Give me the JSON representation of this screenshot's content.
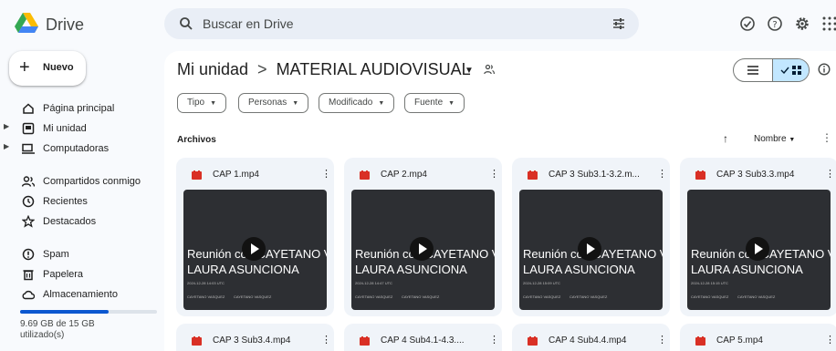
{
  "app": {
    "name": "Drive"
  },
  "search": {
    "placeholder": "Buscar en Drive"
  },
  "sidebar": {
    "new_label": "Nuevo",
    "items": [
      {
        "label": "Página principal",
        "icon": "home-icon"
      },
      {
        "label": "Mi unidad",
        "icon": "my-drive-icon"
      },
      {
        "label": "Computadoras",
        "icon": "computers-icon"
      },
      {
        "label": "Compartidos conmigo",
        "icon": "shared-icon"
      },
      {
        "label": "Recientes",
        "icon": "recent-icon"
      },
      {
        "label": "Destacados",
        "icon": "star-icon"
      },
      {
        "label": "Spam",
        "icon": "spam-icon"
      },
      {
        "label": "Papelera",
        "icon": "trash-icon"
      },
      {
        "label": "Almacenamiento",
        "icon": "cloud-icon"
      }
    ],
    "storage_text": "9.69 GB de 15 GB utilizado(s)",
    "storage_fraction": 0.646
  },
  "breadcrumb": {
    "root": "Mi unidad",
    "separator": ">",
    "current": "MATERIAL AUDIOVISUAL"
  },
  "filters": {
    "tipo": "Tipo",
    "personas": "Personas",
    "modificado": "Modificado",
    "fuente": "Fuente"
  },
  "section": {
    "title": "Archivos"
  },
  "sort": {
    "label": "Nombre"
  },
  "files": [
    {
      "name": "CAP 1.mp4",
      "title1": "Reunión con CAYETANO VA",
      "title2": "LAURA ASUNCIONA",
      "date": "2024-12-28 14:03 UTC",
      "f1": "CAYETANO VASQUEZ",
      "f2": "CAYETANO VASQUEZ"
    },
    {
      "name": "CAP 2.mp4",
      "title1": "Reunión con CAYETANO VA",
      "title2": "LAURA ASUNCIONA",
      "date": "2024-12-28 14:47 UTC",
      "f1": "CAYETANO VASQUEZ",
      "f2": "CAYETANO VASQUEZ"
    },
    {
      "name": "CAP 3 Sub3.1-3.2.m...",
      "title1": "Reunión con CAYETANO VA",
      "title2": "LAURA ASUNCIONA",
      "date": "2024-12-28 15:09 UTC",
      "f1": "CAYETANO VASQUEZ",
      "f2": "CAYETANO VASQUEZ"
    },
    {
      "name": "CAP 3 Sub3.3.mp4",
      "title1": "Reunión con CAYETANO VA",
      "title2": "LAURA ASUNCIONA",
      "date": "2024-12-28 15:15 UTC",
      "f1": "CAYETANO VASQUEZ",
      "f2": "CAYETANO VASQUEZ"
    },
    {
      "name": "CAP 3 Sub3.4.mp4"
    },
    {
      "name": "CAP 4 Sub4.1-4.3...."
    },
    {
      "name": "CAP 4 Sub4.4.mp4"
    },
    {
      "name": "CAP 5.mp4"
    }
  ],
  "colors": {
    "accent": "#0b57d0",
    "selected": "#c2e7ff",
    "video": "#d93025",
    "background": "#f8fafd"
  }
}
